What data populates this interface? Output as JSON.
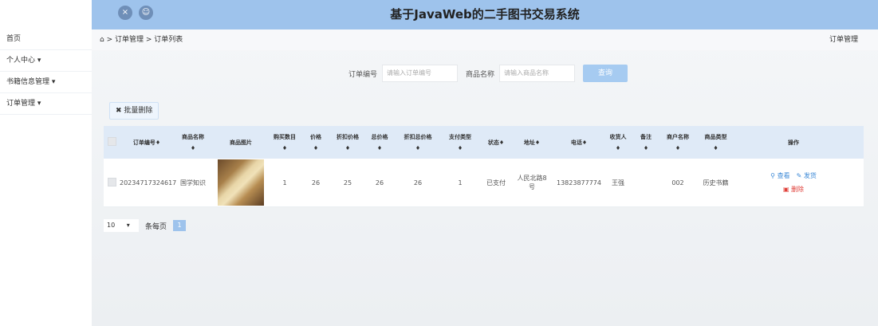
{
  "app": {
    "title": "基于JavaWeb的二手图书交易系统"
  },
  "topbar": {
    "close_icon": "×",
    "user_icon": "☺"
  },
  "sidebar": {
    "items": [
      {
        "label": "首页"
      },
      {
        "label": "个人中心 ▾"
      },
      {
        "label": "书籍信息管理 ▾"
      },
      {
        "label": "订单管理 ▾"
      }
    ]
  },
  "breadcrumb": {
    "home_icon": "⌂",
    "path": "> 订单管理 > 订单列表",
    "right": "订单管理"
  },
  "search": {
    "order_label": "订单编号",
    "order_placeholder": "请输入订单编号",
    "name_label": "商品名称",
    "name_placeholder": "请输入商品名称",
    "query_button": "查询"
  },
  "toolbar": {
    "batch_delete": "批量删除"
  },
  "table": {
    "headers": {
      "order_no": "订单编号",
      "goods_name": "商品名称",
      "goods_img": "商品图片",
      "qty": "购买数目",
      "price": "价格",
      "disc_price": "折扣价格",
      "total": "总价格",
      "disc_total": "折扣总价格",
      "pay_type": "支付类型",
      "status": "状态",
      "address": "地址",
      "phone": "电话",
      "receiver": "收货人",
      "note": "备注",
      "merchant": "商户名称",
      "goods_type": "商品类型",
      "actions": "操作"
    },
    "sort_icon": "♦",
    "rows": [
      {
        "order_no": "20234717324617",
        "goods_name": "国学知识",
        "qty": "1",
        "price": "26",
        "disc_price": "25",
        "total": "26",
        "disc_total": "26",
        "pay_type": "1",
        "status": "已支付",
        "address": "人民北路8号",
        "phone": "13823877774",
        "receiver": "王强",
        "note": "",
        "merchant": "002",
        "goods_type": "历史书籍",
        "view": "查看",
        "ship": "发货",
        "delete": "删除"
      }
    ]
  },
  "pagination": {
    "page_size": "10",
    "per_page_label": "条每页",
    "current": "1"
  }
}
